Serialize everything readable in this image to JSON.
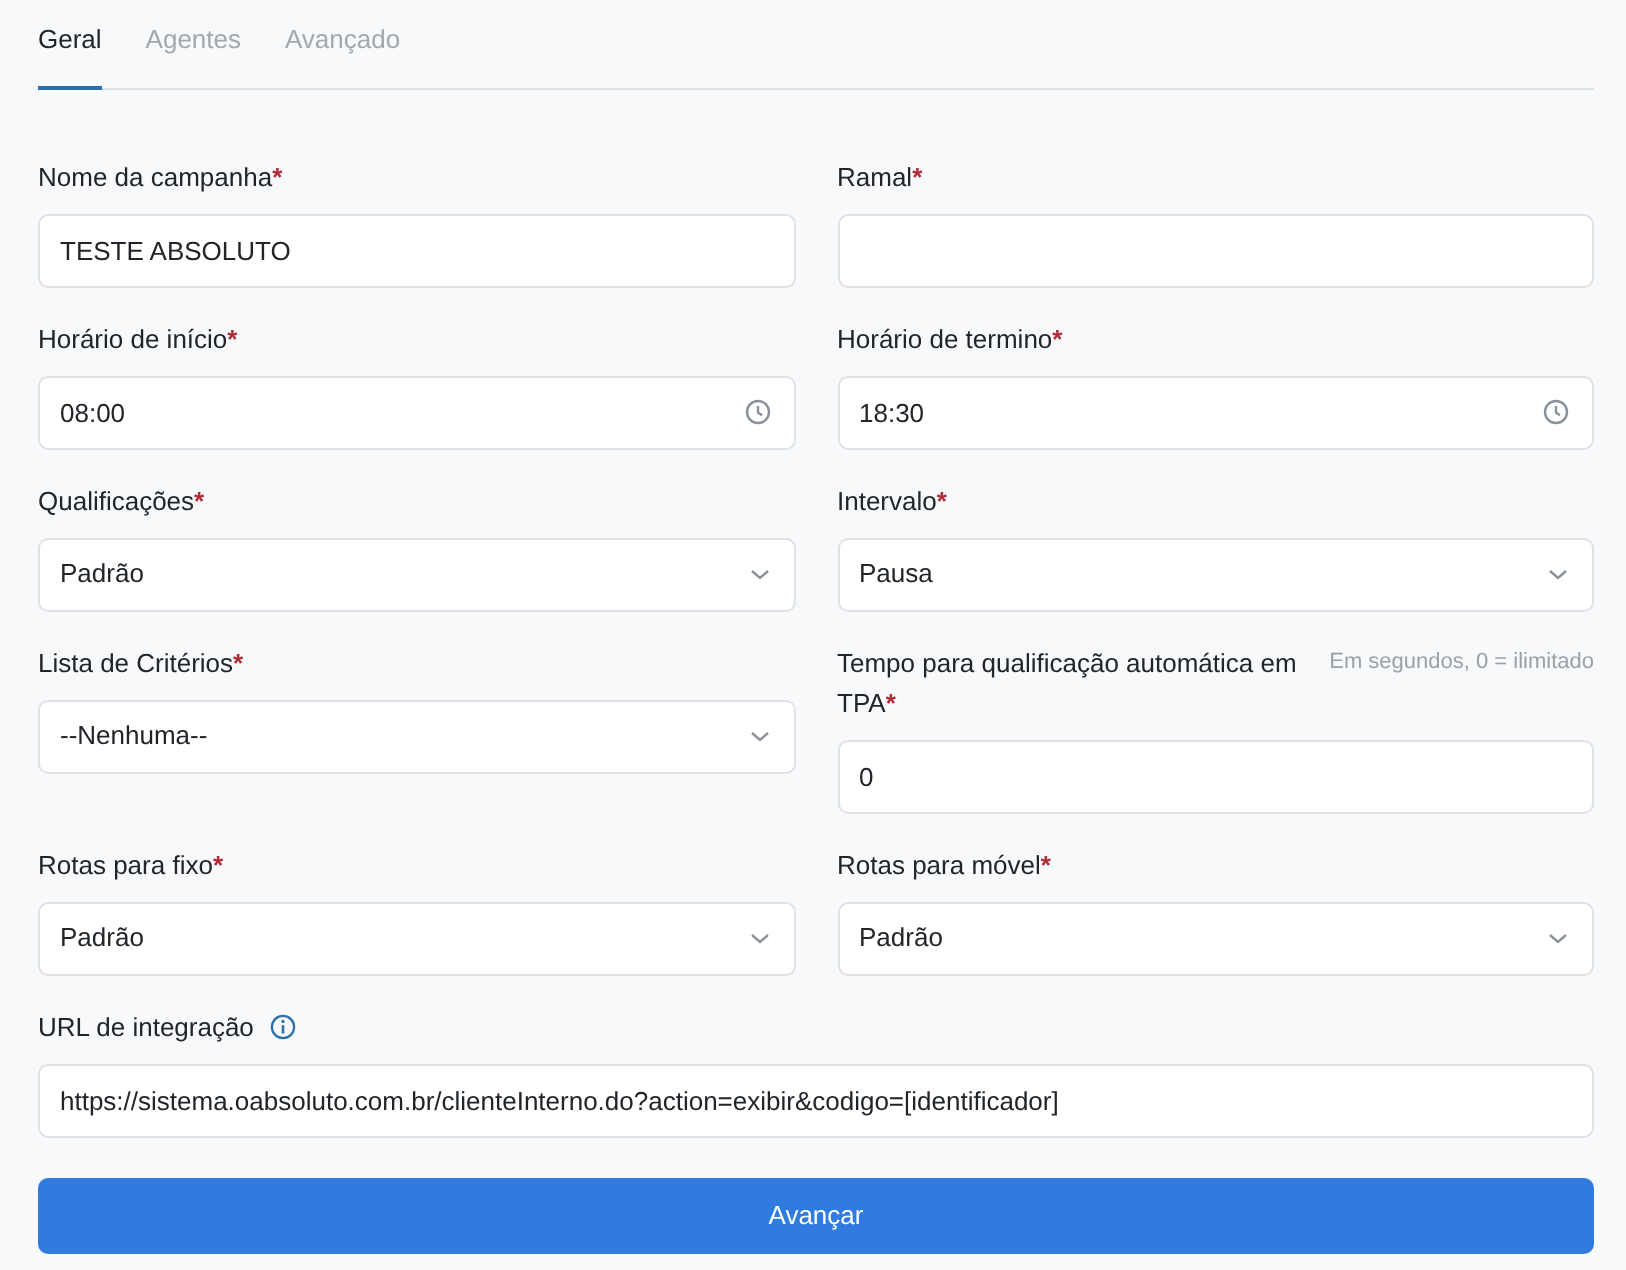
{
  "tabs": [
    {
      "label": "Geral",
      "selected": true
    },
    {
      "label": "Agentes",
      "selected": false
    },
    {
      "label": "Avançado",
      "selected": false
    }
  ],
  "fields": [
    {
      "label": "Nome da campanha",
      "mark": "*",
      "kind": "text",
      "value": "TESTE ABSOLUTO"
    },
    {
      "label": "Ramal",
      "mark": "*",
      "kind": "text"
    },
    {
      "label": "Horário de início",
      "mark": "*",
      "kind": "time",
      "value": "08:00"
    },
    {
      "label": "Horário de termino",
      "mark": "*",
      "kind": "time",
      "value": "18:30"
    },
    {
      "label": "Qualificações",
      "mark": "*",
      "kind": "select",
      "value": "Padrão"
    },
    {
      "label": "Intervalo",
      "mark": "*",
      "kind": "select",
      "value": "Pausa"
    },
    {
      "label": "Lista de Critérios",
      "mark": "*",
      "kind": "select",
      "value": "--Nenhuma--"
    },
    {
      "label": "Tempo para qualificação automática em TPA",
      "mark": "*",
      "hint": "Em segundos, 0 = ilimitado",
      "kind": "text",
      "value": "0"
    },
    {
      "label": "Rotas para fixo",
      "mark": "*",
      "kind": "select",
      "value": "Padrão"
    },
    {
      "label": "Rotas para móvel",
      "mark": "*",
      "kind": "select",
      "value": "Padrão"
    },
    {
      "label": "URL de integração",
      "info": true,
      "full_width": true,
      "kind": "text",
      "value": "https://sistema.oabsoluto.com.br/clienteInterno.do?action=exibir&codigo=[identificador]"
    }
  ],
  "submit": "Avançar"
}
